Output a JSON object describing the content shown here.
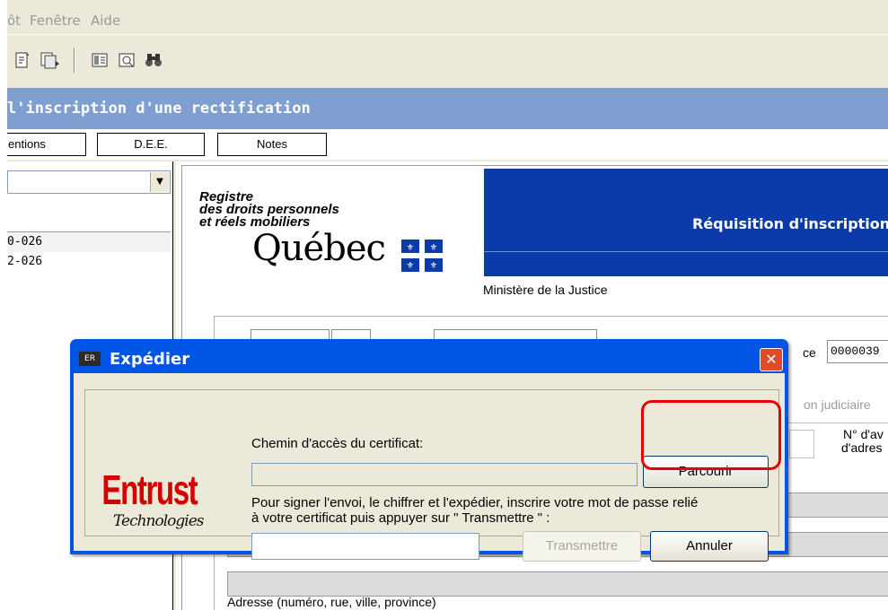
{
  "menubar": {
    "items": [
      "ôt",
      "Fenêtre",
      "Aide"
    ]
  },
  "toolbar": {
    "icons": [
      "new-document-icon",
      "print-preview-icon",
      "form-icon",
      "view-icon",
      "binoculars-icon"
    ]
  },
  "window": {
    "title": "l'inscription d'une rectification"
  },
  "tabs": [
    {
      "label": "entions"
    },
    {
      "label": "D.E.E."
    },
    {
      "label": "Notes"
    }
  ],
  "left_panel": {
    "combo_value": "",
    "list": [
      "0-026",
      "2-026"
    ]
  },
  "document": {
    "registry_line1": "Registre",
    "registry_line2": "des droits personnels",
    "registry_line3": "et réels mobiliers",
    "quebec": "Québec",
    "banner_title": "Réquisition d'inscription",
    "ministere": "Ministère de la Justice",
    "ref_label": "ce",
    "ref_value": "0000039",
    "judiciaire": "on judiciaire",
    "num_label1": "N° d'av",
    "num_label2": "d'adres",
    "adresse_label": "Adresse (numéro, rue, ville, province)"
  },
  "dialog": {
    "title": "Expédier",
    "app_icon_text": "ER",
    "logo_text": "Entrust",
    "logo_sub": "Technologies",
    "path_label": "Chemin d'accès du certificat:",
    "path_value": "",
    "browse_label": "Parcourir",
    "instruction_line1": "Pour signer l'envoi, le chiffrer et l'expédier, inscrire votre mot de passe relié",
    "instruction_line2": "à votre certificat puis appuyer sur \" Transmettre \" :",
    "password_value": "",
    "send_label": "Transmettre",
    "cancel_label": "Annuler",
    "close_symbol": "✕"
  },
  "colors": {
    "titlebar": "#7f9fd1",
    "banner": "#0a3ba8",
    "dialog_titlebar": "#0055e5",
    "highlight": "#e60000",
    "entrust_red": "#d40000"
  }
}
